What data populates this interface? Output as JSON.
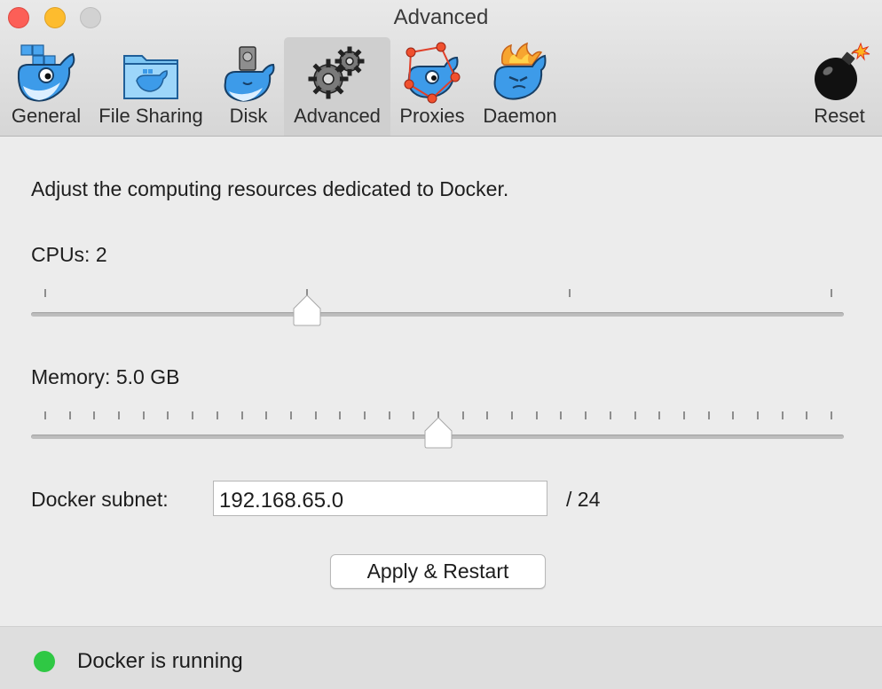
{
  "window": {
    "title": "Advanced"
  },
  "toolbar": {
    "tabs": [
      {
        "label": "General",
        "icon": "docker-whale-general-icon"
      },
      {
        "label": "File Sharing",
        "icon": "folder-whale-icon"
      },
      {
        "label": "Disk",
        "icon": "disk-whale-icon"
      },
      {
        "label": "Advanced",
        "icon": "gears-icon",
        "active": true
      },
      {
        "label": "Proxies",
        "icon": "proxies-whale-icon"
      },
      {
        "label": "Daemon",
        "icon": "daemon-whale-icon"
      }
    ],
    "reset": {
      "label": "Reset",
      "icon": "bomb-icon"
    }
  },
  "main": {
    "intro": "Adjust the computing resources dedicated to Docker.",
    "cpus": {
      "label": "CPUs: 2",
      "value": 2,
      "min": 1,
      "max": 4
    },
    "memory": {
      "label": "Memory: 5.0 GB",
      "value": 5.0,
      "unit": "GB",
      "min": 1,
      "max": 9
    },
    "subnet": {
      "label": "Docker subnet:",
      "value": "192.168.65.0",
      "suffix": "/ 24"
    },
    "apply_button": "Apply & Restart"
  },
  "status": {
    "text": "Docker is running",
    "color": "#2fc844"
  },
  "colors": {
    "active_tab_bg": "#cfcfcf",
    "docker_blue": "#3d9be9"
  }
}
